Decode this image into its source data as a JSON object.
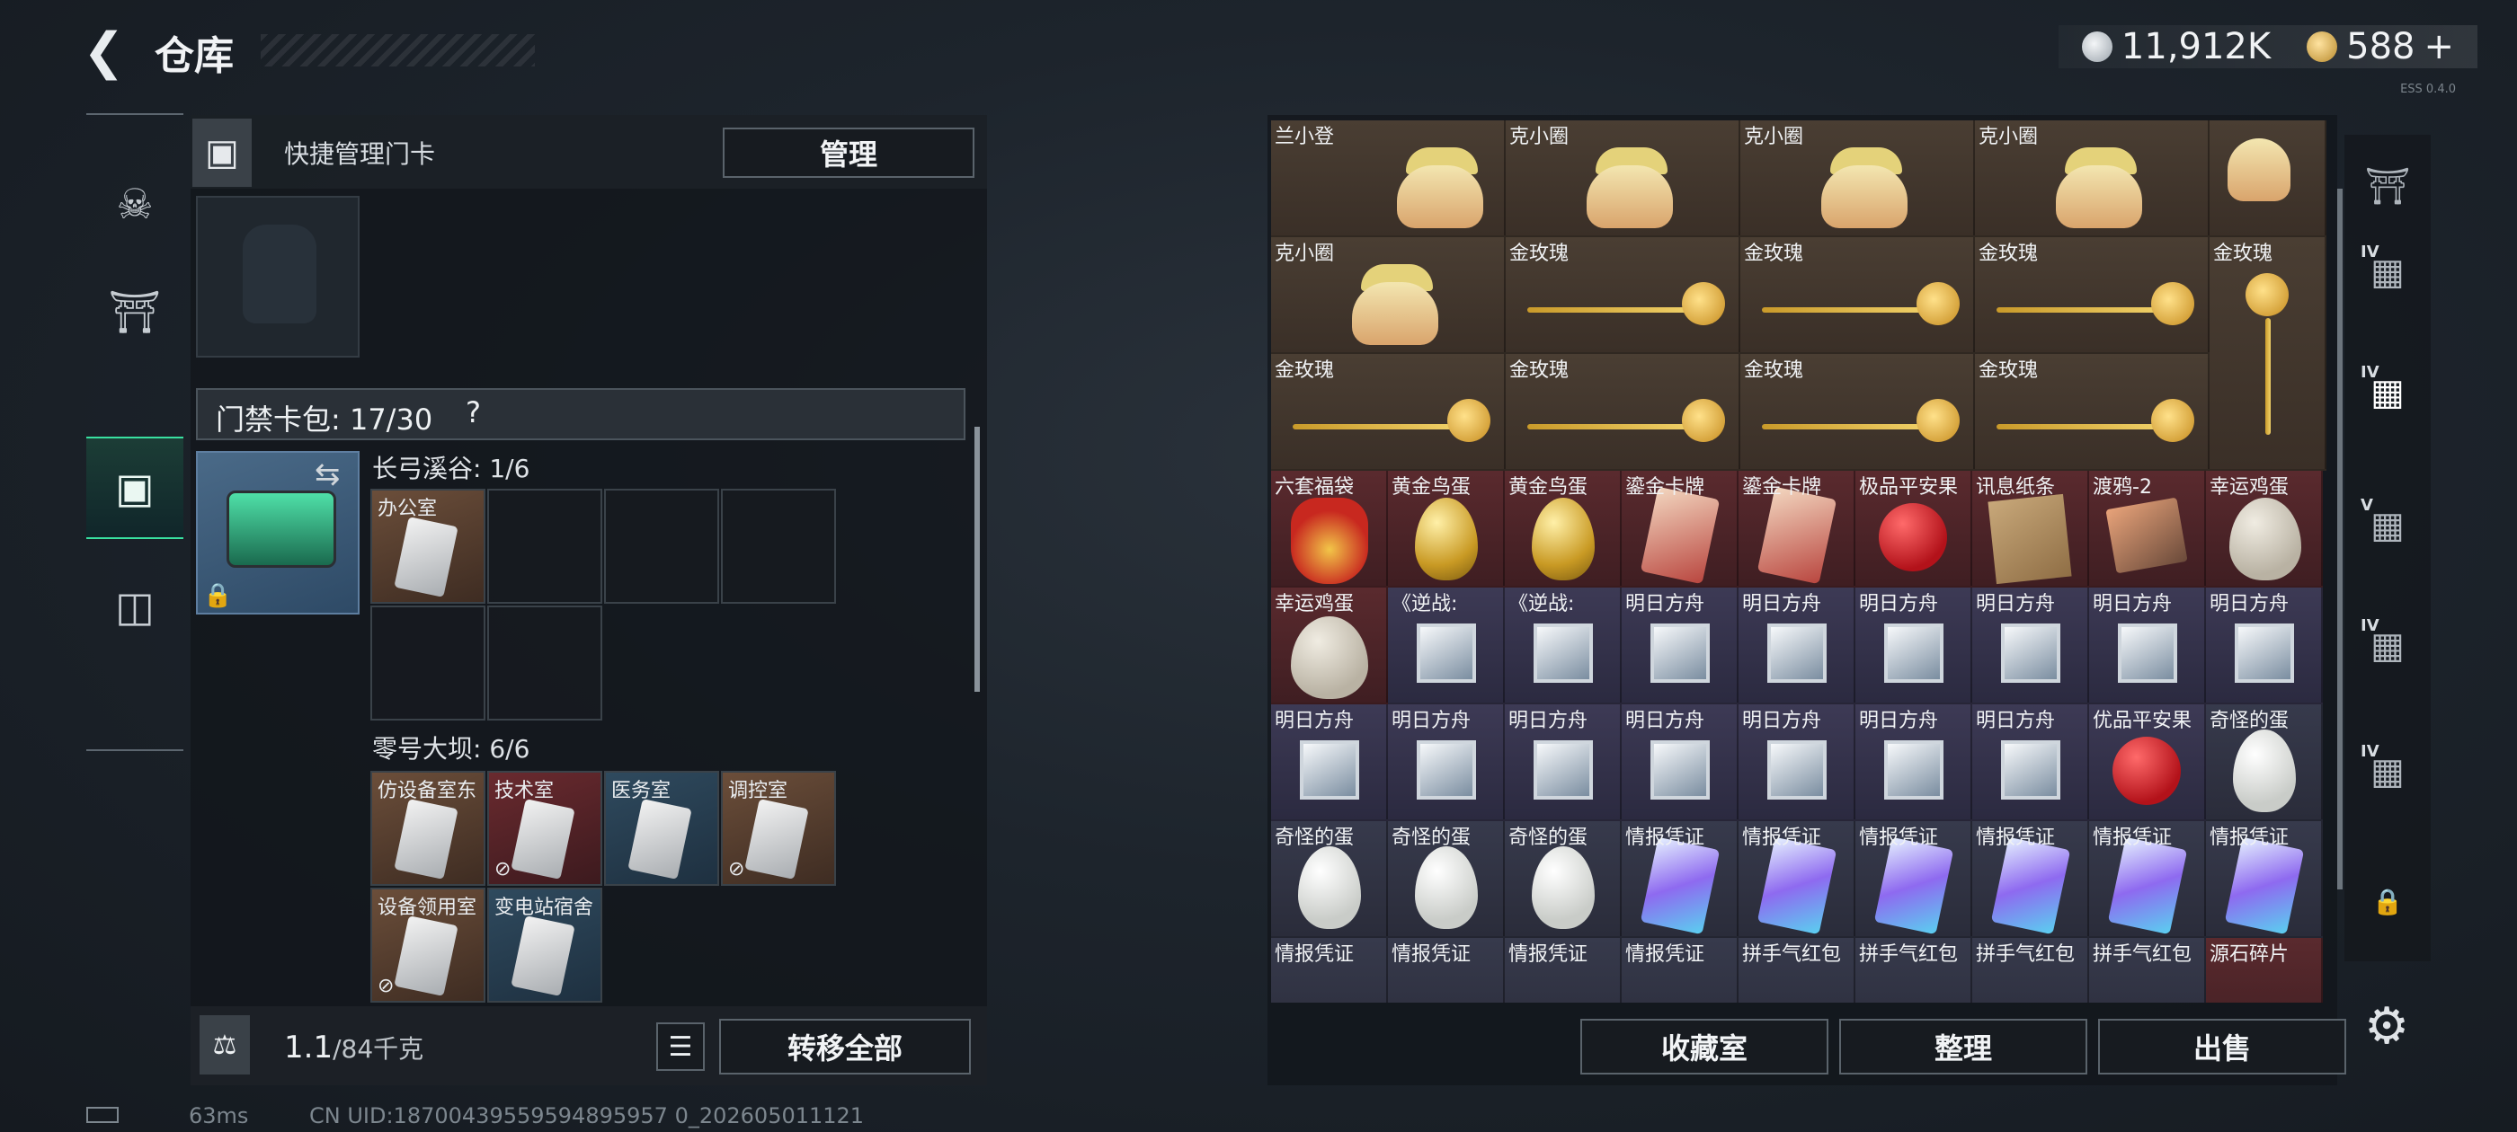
{
  "header": {
    "title": "仓库",
    "currency": [
      {
        "name": "silver-coin-icon",
        "value": "11,912K"
      },
      {
        "name": "gold-coin-icon",
        "value": "588",
        "plus": "+"
      }
    ]
  },
  "left_rail": {
    "items": [
      "gun-icon",
      "vest-icon",
      "keycard-icon",
      "briefcase-icon"
    ],
    "active_index": 2
  },
  "left_panel": {
    "quick_label": "快捷管理门卡",
    "manage_button": "管理",
    "cardbag_label": "门禁卡包: 17/30",
    "help_icon": "?",
    "region1": {
      "title": "长弓溪谷: 1/6",
      "slots": [
        {
          "label": "办公室"
        }
      ]
    },
    "region2": {
      "title": "零号大坝: 6/6",
      "slots": [
        {
          "label": "仿设备室东"
        },
        {
          "label": "技术室"
        },
        {
          "label": "医务室"
        },
        {
          "label": "调控室"
        },
        {
          "label": "设备领用室"
        },
        {
          "label": "变电站宿舍"
        }
      ]
    },
    "weight_value": "1.1",
    "weight_max": "/84千克",
    "transfer_button": "转移全部"
  },
  "right_panel": {
    "rows": [
      [
        "兰小登",
        "克小圈",
        "克小圈",
        "克小圈",
        ""
      ],
      [
        "克小圈",
        "金玫瑰",
        "金玫瑰",
        "金玫瑰",
        "金玫瑰"
      ],
      [
        "金玫瑰",
        "金玫瑰",
        "金玫瑰",
        "金玫瑰",
        ""
      ],
      [
        "六套福袋",
        "黄金鸟蛋",
        "黄金鸟蛋",
        "鎏金卡牌",
        "鎏金卡牌",
        "极品平安果",
        "讯息纸条",
        "渡鸦-2",
        "幸运鸡蛋"
      ],
      [
        "幸运鸡蛋",
        "《逆战:",
        "《逆战:",
        "明日方舟",
        "明日方舟",
        "明日方舟",
        "明日方舟",
        "明日方舟",
        "明日方舟"
      ],
      [
        "明日方舟",
        "明日方舟",
        "明日方舟",
        "明日方舟",
        "明日方舟",
        "明日方舟",
        "明日方舟",
        "优品平安果",
        "奇怪的蛋"
      ],
      [
        "奇怪的蛋",
        "奇怪的蛋",
        "奇怪的蛋",
        "情报凭证",
        "情报凭证",
        "情报凭证",
        "情报凭证",
        "情报凭证",
        "情报凭证"
      ],
      [
        "情报凭证",
        "情报凭证",
        "情报凭证",
        "情报凭证",
        "拼手气红包",
        "拼手气红包",
        "拼手气红包",
        "拼手气红包",
        "源石碎片"
      ]
    ],
    "buttons": [
      "收藏室",
      "整理",
      "出售"
    ]
  },
  "right_rail": {
    "items": [
      {
        "icon": "helmet-icon",
        "level": ""
      },
      {
        "icon": "armor-icon",
        "level": "IV"
      },
      {
        "icon": "armor-icon",
        "level": "IV"
      },
      {
        "icon": "armor-icon",
        "level": "V"
      },
      {
        "icon": "armor-icon",
        "level": "IV"
      },
      {
        "icon": "armor-icon",
        "level": "IV"
      },
      {
        "icon": "lock-icon",
        "level": ""
      }
    ]
  },
  "footer": {
    "ping": "63ms",
    "uid": "CN UID:18700439559594895957 0_202605011121"
  },
  "version": "ESS 0.4.0"
}
